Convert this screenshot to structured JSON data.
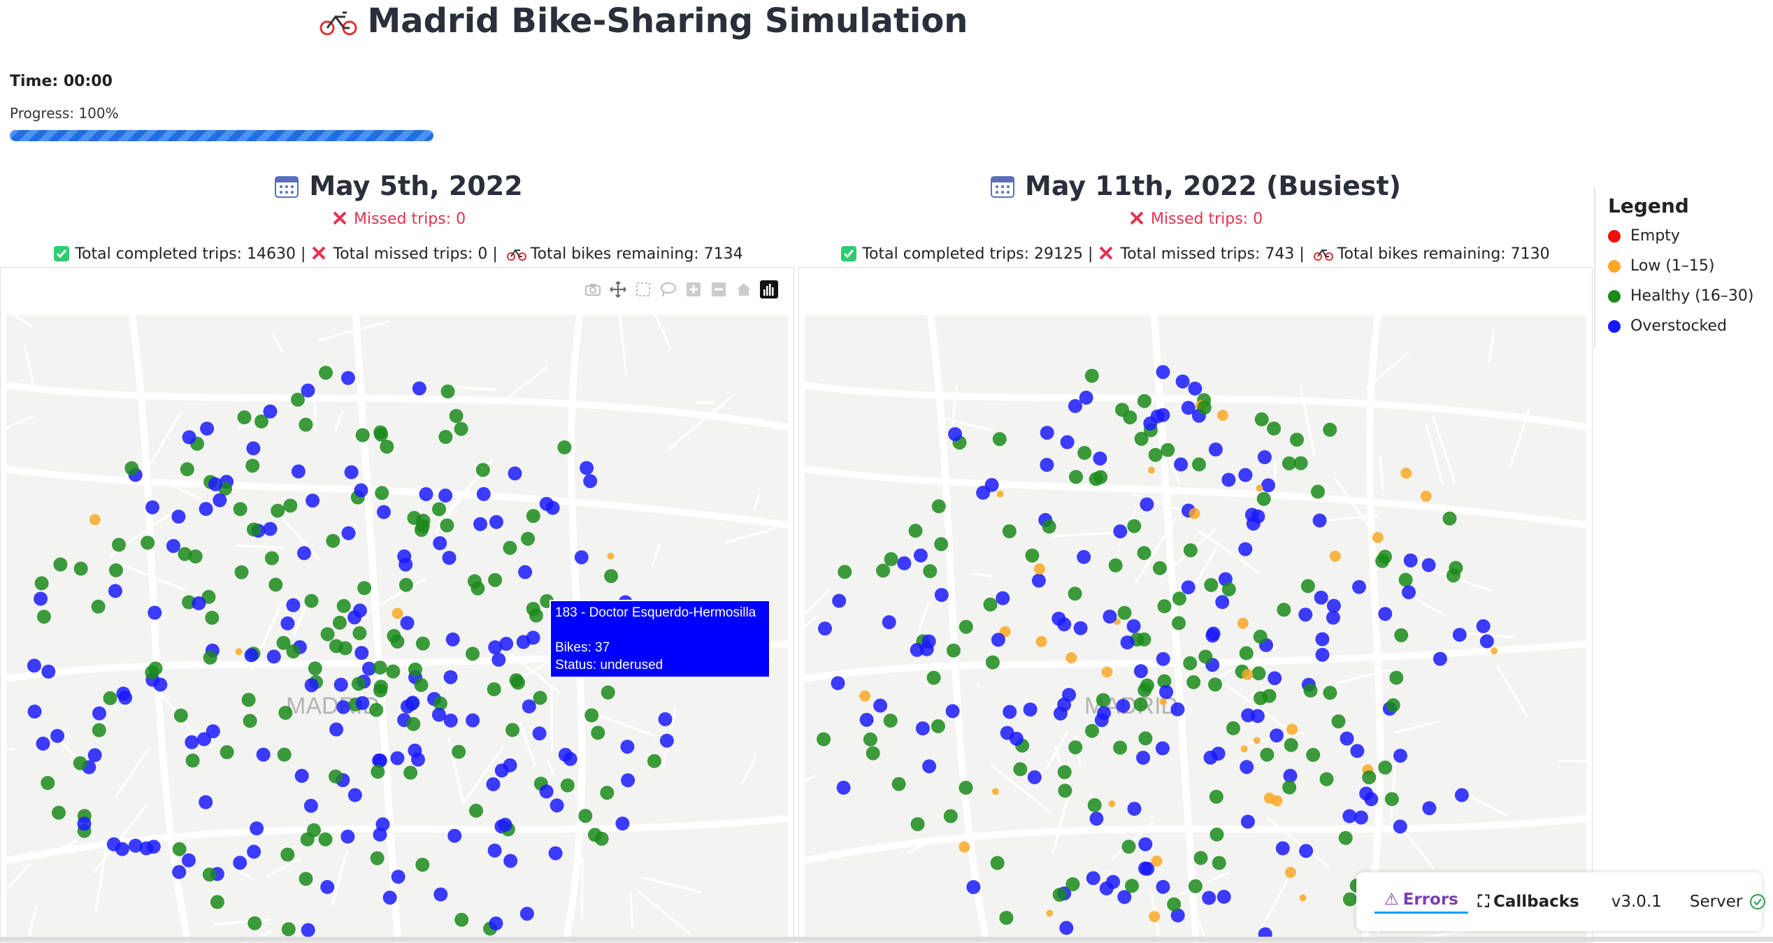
{
  "header": {
    "title": "Madrid Bike-Sharing Simulation",
    "icon": "bicycle-icon"
  },
  "simulation": {
    "time_label": "Time: 00:00",
    "progress_label": "Progress: 100%",
    "progress_percent": 100
  },
  "left_panel": {
    "date_title": "May 5th, 2022",
    "missed_trips": "Missed trips: 0",
    "stats_completed": "Total completed trips: 14630 |",
    "stats_missed": "Total missed trips: 0 |",
    "stats_remaining": "Total bikes remaining: 7134",
    "map_watermark": "MADRID"
  },
  "right_panel": {
    "date_title": "May 11th, 2022 (Busiest)",
    "missed_trips": "Missed trips: 0",
    "stats_completed": "Total completed trips: 29125 |",
    "stats_missed": "Total missed trips: 743 |",
    "stats_remaining": "Total bikes remaining: 7130",
    "map_watermark": "MADRID"
  },
  "tooltip": {
    "line1": "183 - Doctor Esquerdo-Hermosilla",
    "line2": "Bikes: 37",
    "line3": "Status: underused"
  },
  "legend": {
    "title": "Legend",
    "items": [
      {
        "label": "Empty",
        "color": "#ef1010"
      },
      {
        "label": "Low (1–15)",
        "color": "#f9a825"
      },
      {
        "label": "Healthy (16–30)",
        "color": "#1a8a1a"
      },
      {
        "label": "Overstocked",
        "color": "#1a1aff"
      }
    ]
  },
  "devtools": {
    "errors_label": "Errors",
    "callbacks_label": "Callbacks",
    "version": "v3.0.1",
    "server_label": "Server"
  },
  "colors": {
    "overstocked": "#1a1aff",
    "healthy": "#1a8a1a",
    "low": "#f9a825",
    "missed": "#e5304f"
  }
}
